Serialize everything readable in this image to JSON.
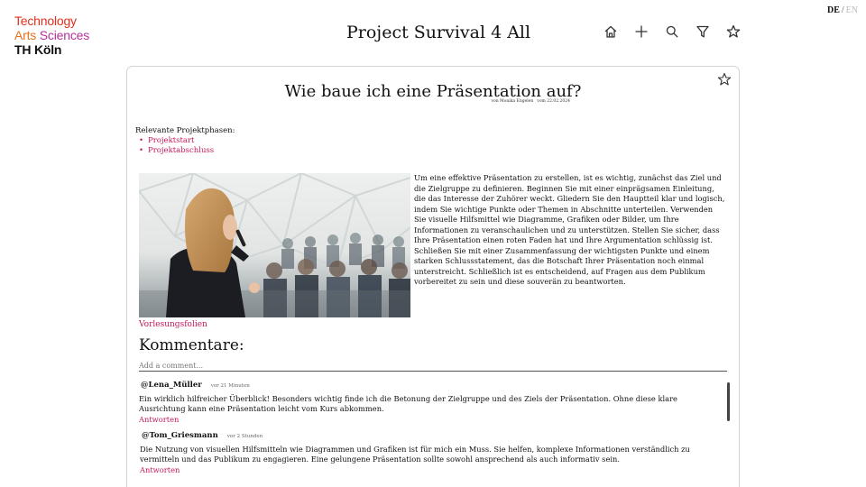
{
  "logo": {
    "line1": "Technology",
    "line2a": "Arts",
    "line2b": "Sciences",
    "line3": "TH Köln"
  },
  "header": {
    "app_title": "Project Survival 4 All",
    "tools": [
      "home-icon",
      "plus-icon",
      "search-icon",
      "filter-icon",
      "star-icon"
    ]
  },
  "lang": {
    "de": "DE",
    "separator": "/",
    "en": "EN"
  },
  "post": {
    "title": "Wie baue ich eine Präsentation auf?",
    "author": "von Monika Engelen",
    "date": "vom 22.02.2024",
    "phases_label": "Relevante Projektphasen:",
    "phases": [
      "Projektstart",
      "Projektabschluss"
    ],
    "body": "Um eine effektive Präsentation zu erstellen, ist es wichtig, zunächst das Ziel und die Zielgruppe zu definieren. Beginnen Sie mit einer einprägsamen Einleitung, die das Interesse der Zuhörer weckt. Gliedern Sie den Hauptteil klar und logisch, indem Sie wichtige Punkte oder Themen in Abschnitte unterteilen. Verwenden Sie visuelle Hilfsmittel wie Diagramme, Grafiken oder Bilder, um Ihre Informationen zu veranschaulichen und zu unterstützen. Stellen Sie sicher, dass Ihre Präsentation einen roten Faden hat und Ihre Argumentation schlüssig ist. Schließen Sie mit einer Zusammenfassung der wichtigsten Punkte und einem starken Schlussstatement, das die Botschaft Ihrer Präsentation noch einmal unterstreicht. Schließlich ist es entscheidend, auf Fragen aus dem Publikum vorbereitet zu sein und diese souverän zu beantworten.",
    "slides_link": "Vorlesungsfolien"
  },
  "comments": {
    "heading": "Kommentare:",
    "placeholder": "Add a comment...",
    "items": [
      {
        "user": "@Lena_Müller",
        "time": "vor 21 Minuten",
        "text": "Ein wirklich hilfreicher Überblick! Besonders wichtig finde ich die Betonung der Zielgruppe und des Ziels der Präsentation. Ohne diese klare Ausrichtung kann eine Präsentation leicht vom Kurs abkommen.",
        "reply": "Antworten"
      },
      {
        "user": "@Tom_Griesmann",
        "time": "vor 2 Stunden",
        "text": "Die Nutzung von visuellen Hilfsmitteln wie Diagrammen und Grafiken ist für mich ein Muss. Sie helfen, komplexe Informationen verständlich zu vermitteln und das Publikum zu engagieren. Eine gelungene Präsentation sollte sowohl ansprechend als auch informativ sein.",
        "reply": "Antworten"
      }
    ]
  },
  "colors": {
    "accent": "#c2185b",
    "logo_red": "#e0301e",
    "logo_orange": "#e5731c",
    "logo_purple": "#b5329b"
  }
}
